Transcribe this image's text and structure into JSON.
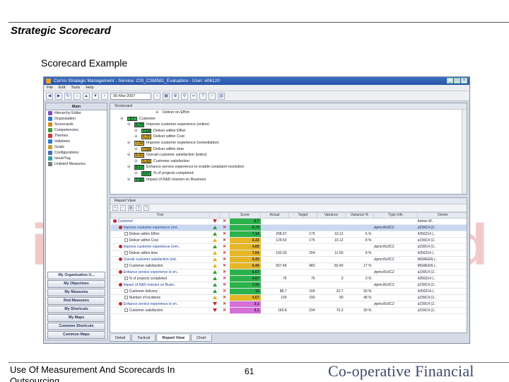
{
  "slide": {
    "title": "Strategic Scorecard",
    "subtitle": "Scorecard Example",
    "footer_text": "Use Of Measurement And Scorecards In Outsourcing",
    "page_number": "61",
    "brand": "Co-operative Financial Services"
  },
  "window": {
    "title": "CorVu Strategic Management - Service: CIS_CSM581_Evaluation - User: e06120",
    "menu": [
      "File",
      "Edit",
      "Tools",
      "Help"
    ],
    "date_value": "06-Mar-2007"
  },
  "left_panel": {
    "header": "Main",
    "items": [
      "Hierarchy Editor",
      "Organisation",
      "Scorecards",
      "Competencies",
      "Themes",
      "Initiatives",
      "Goals",
      "Configurations",
      "Issue/Tag",
      "Unlisted Measures"
    ],
    "nav_buttons": [
      "My Organisation U...",
      "My Objectives",
      "My Measures",
      "Red Measures",
      "My Shortcuts",
      "My Maps",
      "Common Shortcuts",
      "Common Maps"
    ]
  },
  "scorecard_pane": {
    "header": "Scorecard",
    "rows": [
      {
        "indent": 70,
        "badge": "",
        "color": "",
        "label": "Deliver on Effort"
      },
      {
        "indent": 20,
        "badge": "6.7",
        "color": "#2bb24a",
        "label": "Customer"
      },
      {
        "indent": 30,
        "badge": "6.79",
        "color": "#2bb24a",
        "label": "Improve customer experience (online)"
      },
      {
        "indent": 40,
        "badge": "7.14",
        "color": "#2bb24a",
        "label": "Deliver within Effort"
      },
      {
        "indent": 40,
        "badge": "6.32",
        "color": "#e5b626",
        "label": "Deliver within Cost"
      },
      {
        "indent": 30,
        "badge": "7.04",
        "color": "#e5b626",
        "label": "Improve customer experience (remediation)"
      },
      {
        "indent": 40,
        "badge": "7.04",
        "color": "#e5b626",
        "label": "Deliver within time"
      },
      {
        "indent": 30,
        "badge": "5.43",
        "color": "#e5b626",
        "label": "Overall customer satisfaction (index)"
      },
      {
        "indent": 40,
        "badge": "5.43",
        "color": "#e5b626",
        "label": "Customer satisfaction"
      },
      {
        "indent": 30,
        "badge": "5.17",
        "color": "#2bb24a",
        "label": "Enhance service experience to enable complaint resolution"
      },
      {
        "indent": 40,
        "badge": "6.67",
        "color": "#2bb24a",
        "label": "% of projects completed"
      },
      {
        "indent": 30,
        "badge": "7.32",
        "color": "#2bb24a",
        "label": "Impact of R&D mission on Business"
      }
    ]
  },
  "report_pane": {
    "title": "Report View",
    "columns": [
      "Tree",
      "",
      "",
      "Score",
      "Actual",
      "Target",
      "Variance",
      "Variance %",
      "Type Info",
      "Owner"
    ],
    "rows": [
      {
        "indent": 0,
        "flag": "dot",
        "tree": "Customer",
        "t1": "down",
        "t2": "x",
        "score": "6.7",
        "sc_color": "#2bb24a",
        "actual": "",
        "target": "",
        "var": "",
        "varp": "",
        "type": "",
        "owner": "Admin W..",
        "sel": false
      },
      {
        "indent": 8,
        "flag": "dot",
        "tree": "Improve customer experience (onl..",
        "t1": "up",
        "t2": "x",
        "score": "6.79",
        "sc_color": "#2bb24a",
        "actual": "",
        "target": "",
        "var": "",
        "varp": "",
        "type": "ytpmc/6c0C2",
        "owner": "p239C4 (2..",
        "sel": true
      },
      {
        "indent": 16,
        "flag": "box",
        "tree": "Deliver within Effort",
        "t1": "up",
        "t2": "x",
        "score": "7.14",
        "sc_color": "#2bb24a",
        "actual": "208.97",
        "target": "175",
        "var": "10.12",
        "varp": "6 %",
        "type": "",
        "owner": "4256214 (..",
        "sel": false
      },
      {
        "indent": 16,
        "flag": "box",
        "tree": "Deliver within Cost",
        "t1": "yel",
        "t2": "x",
        "score": "6.32",
        "sc_color": "#e5b626",
        "actual": "129.92",
        "target": "175",
        "var": "10.12",
        "varp": "8 %",
        "type": "",
        "owner": "p239C4 (2..",
        "sel": false
      },
      {
        "indent": 8,
        "flag": "dot",
        "tree": "Improve customer experience (rem..",
        "t1": "up",
        "t2": "x",
        "score": "4.89",
        "sc_color": "#e5b626",
        "actual": "",
        "target": "",
        "var": "",
        "varp": "",
        "type": "ytpmc/6c0C2",
        "owner": "p239C4 (2..",
        "sel": false
      },
      {
        "indent": 16,
        "flag": "box",
        "tree": "Deliver within time",
        "t1": "yel",
        "t2": "x",
        "score": "7.04",
        "sc_color": "#e5b626",
        "actual": "192.00",
        "target": "204",
        "var": "11.50",
        "varp": "8 %",
        "type": "",
        "owner": "4256214 (..",
        "sel": false
      },
      {
        "indent": 8,
        "flag": "dot",
        "tree": "Overall customer satisfaction (ind..",
        "t1": "yel",
        "t2": "x",
        "score": "5.43",
        "sc_color": "#e5b626",
        "actual": "",
        "target": "",
        "var": "",
        "varp": "",
        "type": "ytpmc/6c0C2",
        "owner": "MGREEN (..",
        "sel": false
      },
      {
        "indent": 16,
        "flag": "box",
        "tree": "Customer satisfaction",
        "t1": "yel",
        "t2": "x",
        "score": "6.49",
        "sc_color": "#e5b626",
        "actual": "567.49",
        "target": "480",
        "var": "82.40",
        "varp": "17 %",
        "type": "",
        "owner": "MGREEN (..",
        "sel": false
      },
      {
        "indent": 8,
        "flag": "dot",
        "tree": "Enhance service experience to en..",
        "t1": "up",
        "t2": "x",
        "score": "6.67",
        "sc_color": "#2bb24a",
        "actual": "",
        "target": "",
        "var": "",
        "varp": "",
        "type": "ytpmc/6c0C2",
        "owner": "p239C4 (2..",
        "sel": false
      },
      {
        "indent": 16,
        "flag": "box",
        "tree": "% of projects completed",
        "t1": "up",
        "t2": "x",
        "score": "6.67",
        "sc_color": "#2bb24a",
        "actual": "75",
        "target": "75",
        "var": "0",
        "varp": "0 %",
        "type": "",
        "owner": "4256214 (..",
        "sel": false
      },
      {
        "indent": 8,
        "flag": "dot",
        "tree": "Impact of R&D mission on Busin..",
        "t1": "up",
        "t2": "x",
        "score": "7.32",
        "sc_color": "#2bb24a",
        "actual": "",
        "target": "",
        "var": "",
        "varp": "",
        "type": "ytpmc/6c0C2",
        "owner": "p239C4 (2..",
        "sel": false
      },
      {
        "indent": 16,
        "flag": "box",
        "tree": "Customer delivery",
        "t1": "up",
        "t2": "x",
        "score": "10",
        "sc_color": "#2bb24a",
        "actual": "88.7",
        "target": "100",
        "var": "22.7",
        "varp": "30 %",
        "type": "",
        "owner": "4256214 (..",
        "sel": false
      },
      {
        "indent": 16,
        "flag": "box",
        "tree": "Number of incidents",
        "t1": "yel",
        "t2": "x",
        "score": "4.67",
        "sc_color": "#e5b626",
        "actual": "100",
        "target": "190",
        "var": "90",
        "varp": "48 %",
        "type": "",
        "owner": "p239C4 (2..",
        "sel": false
      },
      {
        "indent": 8,
        "flag": "dot",
        "tree": "Enhance service experience to en..",
        "t1": "down",
        "t2": "x",
        "score": "3.1",
        "sc_color": "#d66fd8",
        "actual": "",
        "target": "",
        "var": "",
        "varp": "",
        "type": "ytpmc/6c0C2",
        "owner": "p239C4 (2..",
        "sel": false
      },
      {
        "indent": 16,
        "flag": "box",
        "tree": "Customer satisfaction",
        "t1": "down",
        "t2": "x",
        "score": "3.1",
        "sc_color": "#d66fd8",
        "actual": "163.8",
        "target": "234",
        "var": "70.2",
        "varp": "30 %",
        "type": "",
        "owner": "p239C4 (2..",
        "sel": false
      }
    ],
    "tabs": [
      "Detail",
      "Tactical",
      "Report View",
      "Chart"
    ],
    "active_tab": 2
  }
}
